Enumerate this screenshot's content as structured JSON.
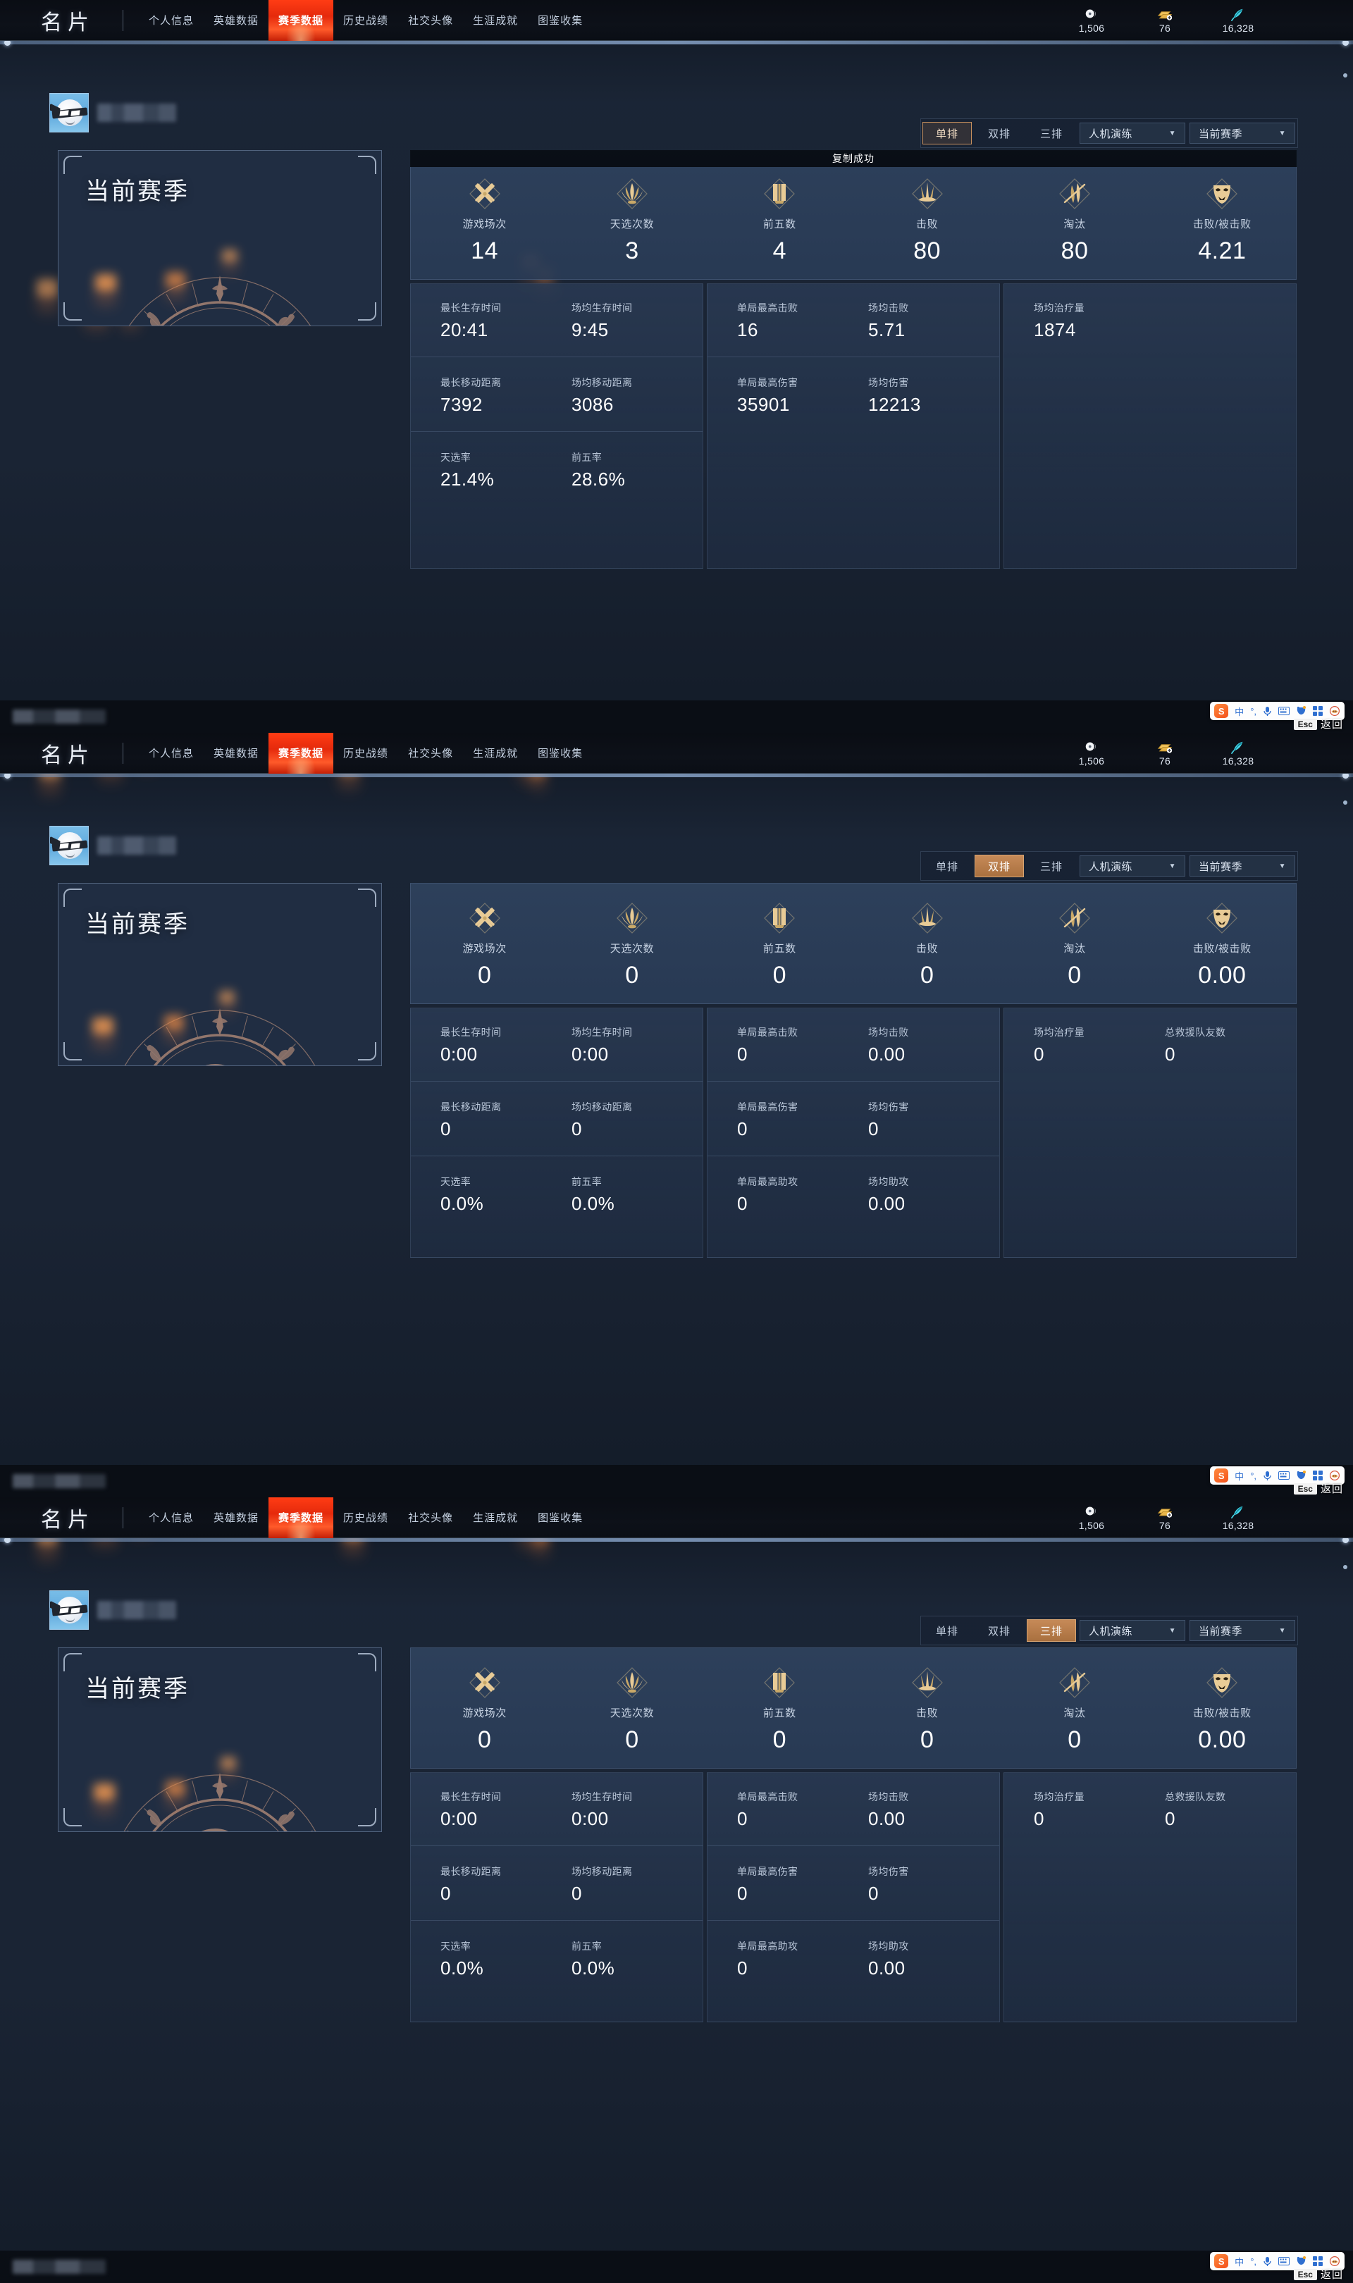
{
  "header": {
    "brand": "名片",
    "nav": [
      {
        "label": "个人信息",
        "active": false
      },
      {
        "label": "英雄数据",
        "active": false
      },
      {
        "label": "赛季数据",
        "active": true
      },
      {
        "label": "历史战绩",
        "active": false
      },
      {
        "label": "社交头像",
        "active": false
      },
      {
        "label": "生涯成就",
        "active": false
      },
      {
        "label": "图鉴收集",
        "active": false
      }
    ],
    "currencies": [
      {
        "icon": "yinliang-currency-icon",
        "value": "1,506"
      },
      {
        "icon": "gold-bar-currency-icon",
        "value": "76"
      },
      {
        "icon": "feather-currency-icon",
        "value": "16,328"
      }
    ]
  },
  "toast": {
    "text": "复制成功"
  },
  "filters": {
    "modes": [
      "单排",
      "双排",
      "三排"
    ],
    "match_type": "人机演练",
    "season": "当前赛季"
  },
  "season_card": {
    "title": "当前赛季",
    "emblem": "phoenix-emblem-icon"
  },
  "os_bar": {
    "ime_lang": "中",
    "ime_punct": "°,",
    "esc_key": "Esc",
    "esc_label": "返回"
  },
  "sections": [
    {
      "mode_selected": "单排",
      "selected_style": "outline",
      "show_toast": true,
      "headline": [
        {
          "icon": "crossed-swords-icon",
          "label": "游戏场次",
          "value": "14"
        },
        {
          "icon": "phoenix-crest-icon",
          "label": "天选次数",
          "value": "3"
        },
        {
          "icon": "banner-scroll-icon",
          "label": "前五数",
          "value": "4"
        },
        {
          "icon": "crown-blades-icon",
          "label": "击败",
          "value": "80"
        },
        {
          "icon": "slash-blade-icon",
          "label": "淘汰",
          "value": "80"
        },
        {
          "icon": "mask-icon",
          "label": "击败/被击败",
          "value": "4.21"
        }
      ],
      "columns": [
        {
          "rows": [
            [
              {
                "label": "最长生存时间",
                "value": "20:41"
              },
              {
                "label": "场均生存时间",
                "value": "9:45"
              }
            ],
            [
              {
                "label": "最长移动距离",
                "value": "7392"
              },
              {
                "label": "场均移动距离",
                "value": "3086"
              }
            ],
            [
              {
                "label": "天选率",
                "value": "21.4%"
              },
              {
                "label": "前五率",
                "value": "28.6%"
              }
            ]
          ]
        },
        {
          "rows": [
            [
              {
                "label": "单局最高击败",
                "value": "16"
              },
              {
                "label": "场均击败",
                "value": "5.71"
              }
            ],
            [
              {
                "label": "单局最高伤害",
                "value": "35901"
              },
              {
                "label": "场均伤害",
                "value": "12213"
              }
            ]
          ]
        },
        {
          "rows": [
            [
              {
                "label": "场均治疗量",
                "value": "1874"
              }
            ]
          ]
        }
      ]
    },
    {
      "mode_selected": "双排",
      "selected_style": "fill",
      "show_toast": false,
      "headline": [
        {
          "icon": "crossed-swords-icon",
          "label": "游戏场次",
          "value": "0"
        },
        {
          "icon": "phoenix-crest-icon",
          "label": "天选次数",
          "value": "0"
        },
        {
          "icon": "banner-scroll-icon",
          "label": "前五数",
          "value": "0"
        },
        {
          "icon": "crown-blades-icon",
          "label": "击败",
          "value": "0"
        },
        {
          "icon": "slash-blade-icon",
          "label": "淘汰",
          "value": "0"
        },
        {
          "icon": "mask-icon",
          "label": "击败/被击败",
          "value": "0.00"
        }
      ],
      "columns": [
        {
          "rows": [
            [
              {
                "label": "最长生存时间",
                "value": "0:00"
              },
              {
                "label": "场均生存时间",
                "value": "0:00"
              }
            ],
            [
              {
                "label": "最长移动距离",
                "value": "0"
              },
              {
                "label": "场均移动距离",
                "value": "0"
              }
            ],
            [
              {
                "label": "天选率",
                "value": "0.0%"
              },
              {
                "label": "前五率",
                "value": "0.0%"
              }
            ]
          ]
        },
        {
          "rows": [
            [
              {
                "label": "单局最高击败",
                "value": "0"
              },
              {
                "label": "场均击败",
                "value": "0.00"
              }
            ],
            [
              {
                "label": "单局最高伤害",
                "value": "0"
              },
              {
                "label": "场均伤害",
                "value": "0"
              }
            ],
            [
              {
                "label": "单局最高助攻",
                "value": "0"
              },
              {
                "label": "场均助攻",
                "value": "0.00"
              }
            ]
          ]
        },
        {
          "rows": [
            [
              {
                "label": "场均治疗量",
                "value": "0"
              },
              {
                "label": "总救援队友数",
                "value": "0"
              }
            ]
          ]
        }
      ]
    },
    {
      "mode_selected": "三排",
      "selected_style": "fill",
      "show_toast": false,
      "headline": [
        {
          "icon": "crossed-swords-icon",
          "label": "游戏场次",
          "value": "0"
        },
        {
          "icon": "phoenix-crest-icon",
          "label": "天选次数",
          "value": "0"
        },
        {
          "icon": "banner-scroll-icon",
          "label": "前五数",
          "value": "0"
        },
        {
          "icon": "crown-blades-icon",
          "label": "击败",
          "value": "0"
        },
        {
          "icon": "slash-blade-icon",
          "label": "淘汰",
          "value": "0"
        },
        {
          "icon": "mask-icon",
          "label": "击败/被击败",
          "value": "0.00"
        }
      ],
      "columns": [
        {
          "rows": [
            [
              {
                "label": "最长生存时间",
                "value": "0:00"
              },
              {
                "label": "场均生存时间",
                "value": "0:00"
              }
            ],
            [
              {
                "label": "最长移动距离",
                "value": "0"
              },
              {
                "label": "场均移动距离",
                "value": "0"
              }
            ],
            [
              {
                "label": "天选率",
                "value": "0.0%"
              },
              {
                "label": "前五率",
                "value": "0.0%"
              }
            ]
          ]
        },
        {
          "rows": [
            [
              {
                "label": "单局最高击败",
                "value": "0"
              },
              {
                "label": "场均击败",
                "value": "0.00"
              }
            ],
            [
              {
                "label": "单局最高伤害",
                "value": "0"
              },
              {
                "label": "场均伤害",
                "value": "0"
              }
            ],
            [
              {
                "label": "单局最高助攻",
                "value": "0"
              },
              {
                "label": "场均助攻",
                "value": "0.00"
              }
            ]
          ]
        },
        {
          "rows": [
            [
              {
                "label": "场均治疗量",
                "value": "0"
              },
              {
                "label": "总救援队友数",
                "value": "0"
              }
            ]
          ]
        }
      ]
    }
  ]
}
